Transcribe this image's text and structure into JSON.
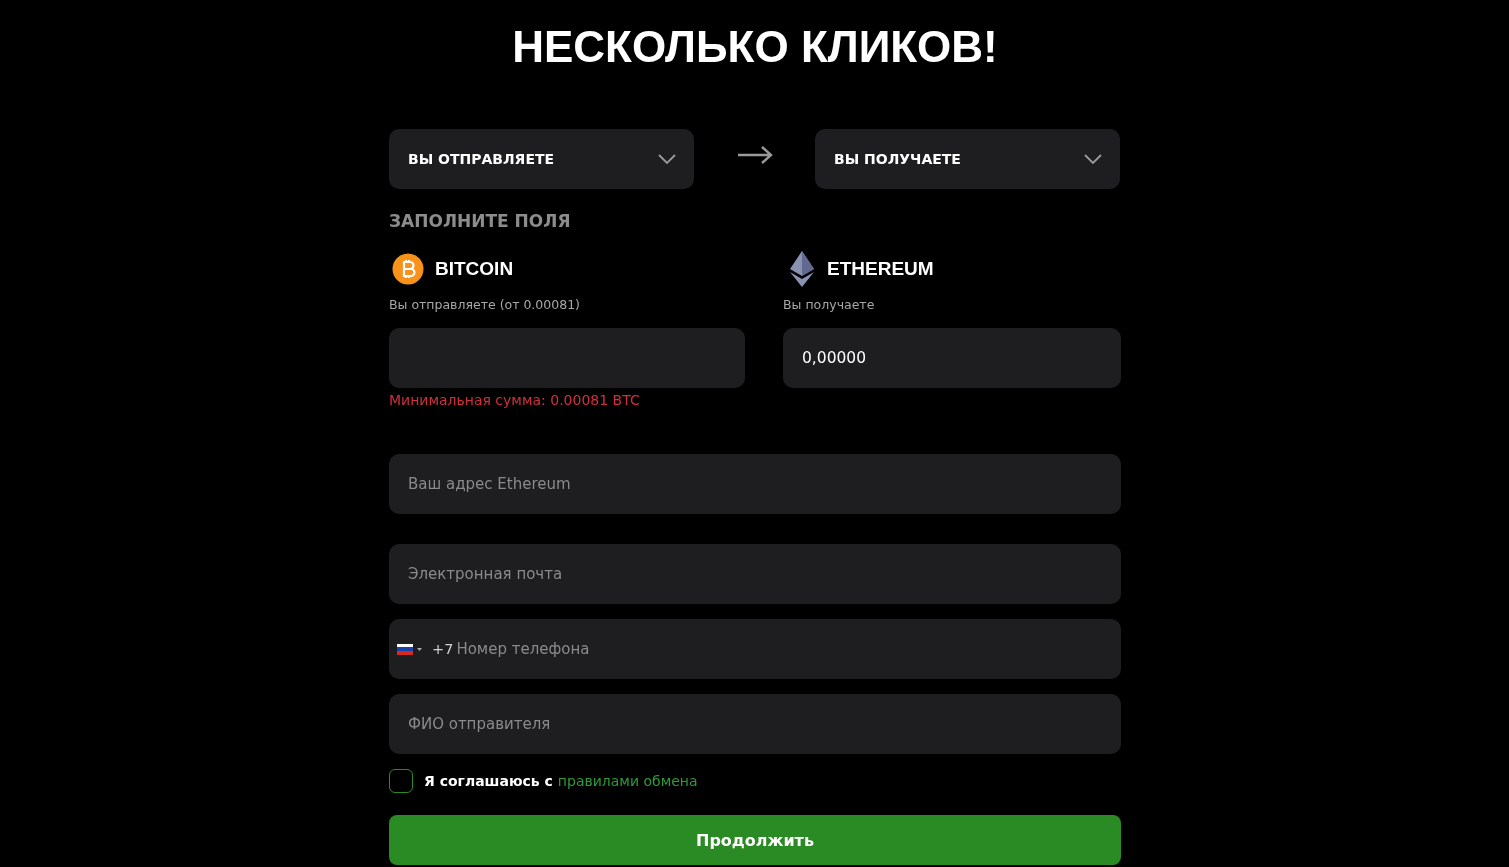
{
  "heading": "НЕСКОЛЬКО КЛИКОВ!",
  "selectors": [
    {
      "label": "ВЫ ОТПРАВЛЯЕТЕ"
    },
    {
      "label": "ВЫ ПОЛУЧАЕТЕ"
    }
  ],
  "section_title": "ЗАПОЛНИТЕ ПОЛЯ",
  "send": {
    "currency": "BITCOIN",
    "label": "Вы отправляете (от 0.00081)",
    "error": "Минимальная сумма: 0.00081 BTC"
  },
  "receive": {
    "currency": "ETHEREUM",
    "label": "Вы получаете",
    "value": "0,00000"
  },
  "fields": [
    {
      "kind": "text",
      "placeholder": "Ваш адрес Ethereum"
    },
    {
      "kind": "text",
      "placeholder": "Электронная почта"
    },
    {
      "kind": "phone",
      "prefix": "+7",
      "placeholder": "Номер телефона"
    },
    {
      "kind": "text",
      "placeholder": "ФИО отправителя"
    }
  ],
  "agreement": {
    "checked": false,
    "text": "Я соглашаюсь с",
    "link": "правилами обмена"
  },
  "submit": "Продолжить"
}
